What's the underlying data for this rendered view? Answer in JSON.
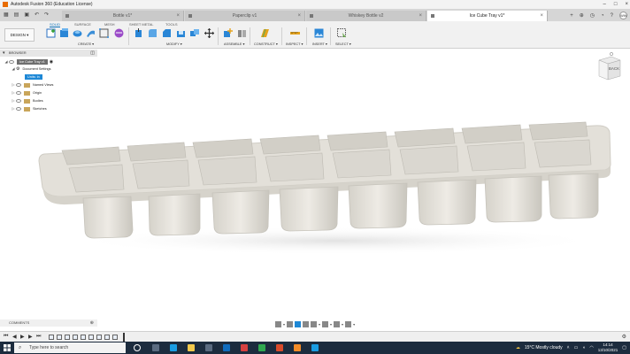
{
  "window": {
    "title": "Autodesk Fusion 360 (Education License)"
  },
  "tabs": [
    {
      "label": "Bottle v1*",
      "active": false
    },
    {
      "label": "Paperclip v1",
      "active": false
    },
    {
      "label": "Whiskey Bottle v2",
      "active": false
    },
    {
      "label": "Ice Cube Tray v1*",
      "active": true
    }
  ],
  "user": {
    "initials": "WW"
  },
  "toolbar": {
    "workspace_button": "DESIGN",
    "mode_tabs": [
      "SOLID",
      "SURFACE",
      "MESH",
      "SHEET METAL",
      "TOOLS"
    ],
    "active_mode": "SOLID",
    "groups": [
      "CREATE",
      "MODIFY",
      "ASSEMBLE",
      "CONSTRUCT",
      "INSPECT",
      "INSERT",
      "SELECT"
    ]
  },
  "browser": {
    "title": "BROWSER",
    "root": "Ice Cube Tray v1",
    "document_settings": "Document Settings",
    "units": "Units: in",
    "items": [
      "Named Views",
      "Origin",
      "Bodies",
      "Sketches"
    ]
  },
  "viewcube": {
    "face": "BACK"
  },
  "comments": {
    "label": "COMMENTS"
  },
  "taskbar": {
    "search_placeholder": "Type here to search",
    "weather": "15°C  Mostly cloudy",
    "time": "14:14",
    "date": "13/10/2021"
  },
  "colors": {
    "accent": "#0d72b9",
    "selection": "#1e88d6",
    "model": "#e6e3dc",
    "taskbar": "#1c2c3e"
  }
}
